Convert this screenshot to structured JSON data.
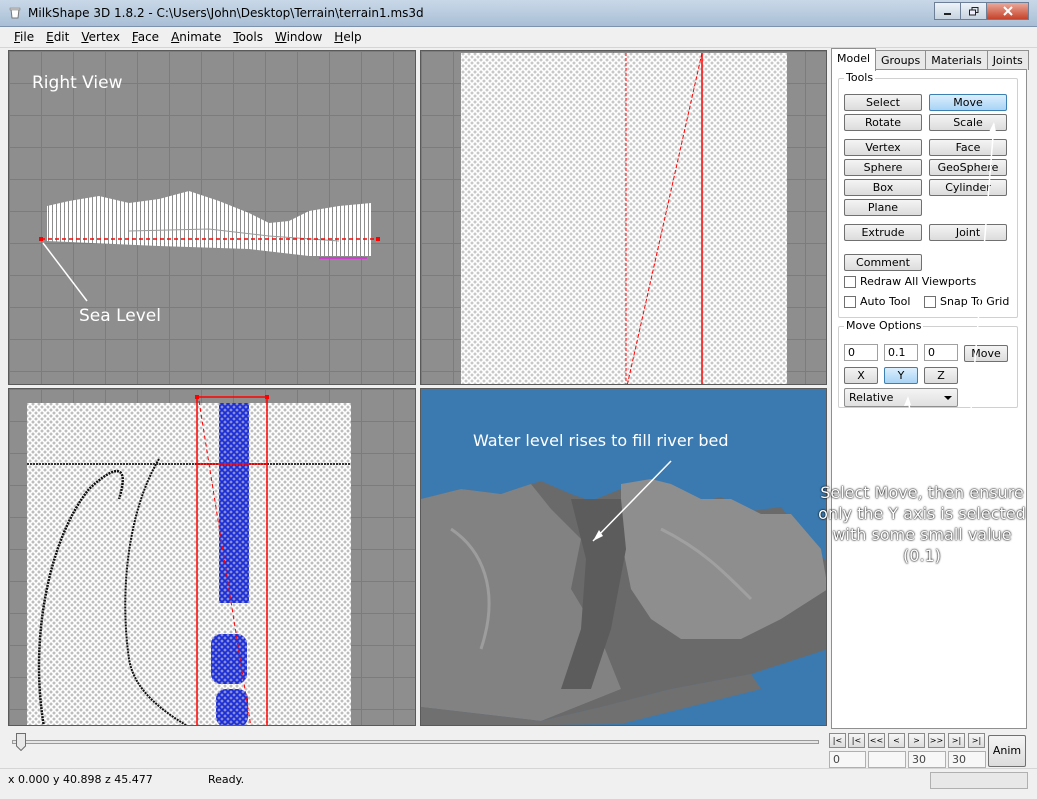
{
  "window": {
    "title": "MilkShape 3D 1.8.2 - C:\\Users\\John\\Desktop\\Terrain\\terrain1.ms3d"
  },
  "menu": [
    {
      "u": "F",
      "rest": "ile"
    },
    {
      "u": "E",
      "rest": "dit"
    },
    {
      "u": "V",
      "rest": "ertex"
    },
    {
      "u": "F",
      "rest": "ace"
    },
    {
      "u": "A",
      "rest": "nimate"
    },
    {
      "u": "T",
      "rest": "ools"
    },
    {
      "u": "W",
      "rest": "indow"
    },
    {
      "u": "H",
      "rest": "elp"
    }
  ],
  "viewports": {
    "top_left_label": "Right View",
    "sea_level_note": "Sea Level",
    "water_note": "Water level rises to fill river bed"
  },
  "panel": {
    "tabs": [
      "Model",
      "Groups",
      "Materials",
      "Joints"
    ],
    "active_tab": "Model",
    "tools_title": "Tools",
    "tools": {
      "select": "Select",
      "move": "Move",
      "rotate": "Rotate",
      "scale": "Scale",
      "vertex": "Vertex",
      "face": "Face",
      "sphere": "Sphere",
      "geosphere": "GeoSphere",
      "box": "Box",
      "cylinder": "Cylinder",
      "plane": "Plane",
      "extrude": "Extrude",
      "joint": "Joint",
      "comment": "Comment"
    },
    "checks": {
      "redraw": "Redraw All Viewports",
      "autotool": "Auto Tool",
      "snap": "Snap To Grid"
    },
    "move_options": {
      "title": "Move Options",
      "x": "0",
      "y": "0.1",
      "z": "0",
      "move_btn": "Move",
      "axis_x": "X",
      "axis_y": "Y",
      "axis_z": "Z",
      "mode": "Relative"
    },
    "instruction": "Select Move, then ensure only the Y axis is selected with some small value (0.1)"
  },
  "timeline": {
    "play_buttons": [
      "|<",
      "|<",
      "<<",
      "<",
      ">",
      ">>",
      ">|",
      ">|"
    ],
    "frame": "0",
    "start": "30",
    "end": "30",
    "anim": "Anim"
  },
  "status": {
    "coords": "x 0.000 y 40.898 z 45.477",
    "message": "Ready."
  },
  "colors": {
    "viewport_bg": "#8e8e8e",
    "water": "#3a7ab0",
    "river_vertices": "#1c2ed6",
    "selection": "#ff0000"
  }
}
